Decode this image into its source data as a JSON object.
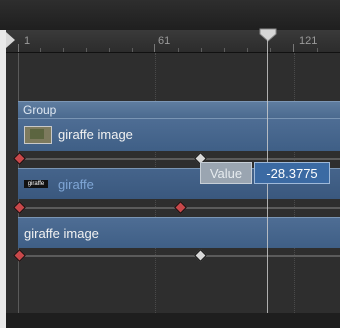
{
  "ruler": {
    "labels": [
      "1",
      "61",
      "121"
    ]
  },
  "group": {
    "title": "Group"
  },
  "layers": [
    {
      "name": "giraffe image",
      "thumb_text": ""
    },
    {
      "name": "giraffe",
      "thumb_text": "giraffe"
    },
    {
      "name": "giraffe image"
    }
  ],
  "value_editor": {
    "label": "Value",
    "value": "-28.3775"
  },
  "colors": {
    "accent_blue": "#3b6aa3",
    "layer_blue": "#4b6a8f",
    "keyframe_red": "#c8484a",
    "keyframe_white": "#d8d8d8"
  },
  "icons": {
    "playhead": "playhead-icon",
    "start_marker": "start-marker-icon",
    "keyframe": "keyframe-icon"
  }
}
